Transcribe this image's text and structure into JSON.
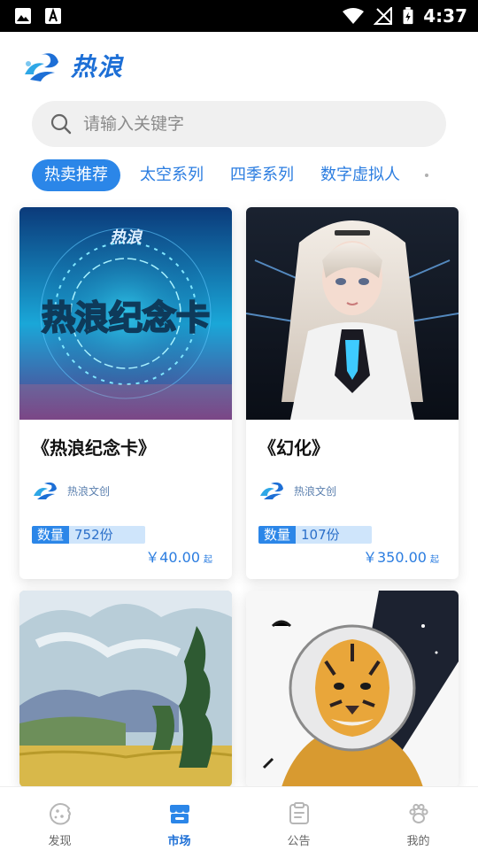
{
  "status_bar": {
    "time": "4:37"
  },
  "header": {
    "logo_text": "热浪"
  },
  "search": {
    "placeholder": "请输入关键字"
  },
  "tabs": [
    {
      "label": "热卖推荐",
      "active": true
    },
    {
      "label": "太空系列",
      "active": false
    },
    {
      "label": "四季系列",
      "active": false
    },
    {
      "label": "数字虚拟人",
      "active": false
    }
  ],
  "cards": [
    {
      "title": "《热浪纪念卡》",
      "image_text": "热浪纪念卡",
      "image_logo": "热浪",
      "creator": "热浪文创",
      "qty_label": "数量",
      "qty_value": "752份",
      "price": "￥40.00",
      "price_suffix": "起"
    },
    {
      "title": "《幻化》",
      "creator": "热浪文创",
      "qty_label": "数量",
      "qty_value": "107份",
      "price": "￥350.00",
      "price_suffix": "起"
    },
    {
      "title": ""
    },
    {
      "title": ""
    }
  ],
  "bottom_nav": [
    {
      "label": "发现",
      "icon": "cookie-icon",
      "active": false
    },
    {
      "label": "市场",
      "icon": "store-icon",
      "active": true
    },
    {
      "label": "公告",
      "icon": "notice-icon",
      "active": false
    },
    {
      "label": "我的",
      "icon": "paw-icon",
      "active": false
    }
  ],
  "colors": {
    "accent": "#2b86e8",
    "brand": "#1d6fd6",
    "qty_bg": "#cfe5fb"
  }
}
